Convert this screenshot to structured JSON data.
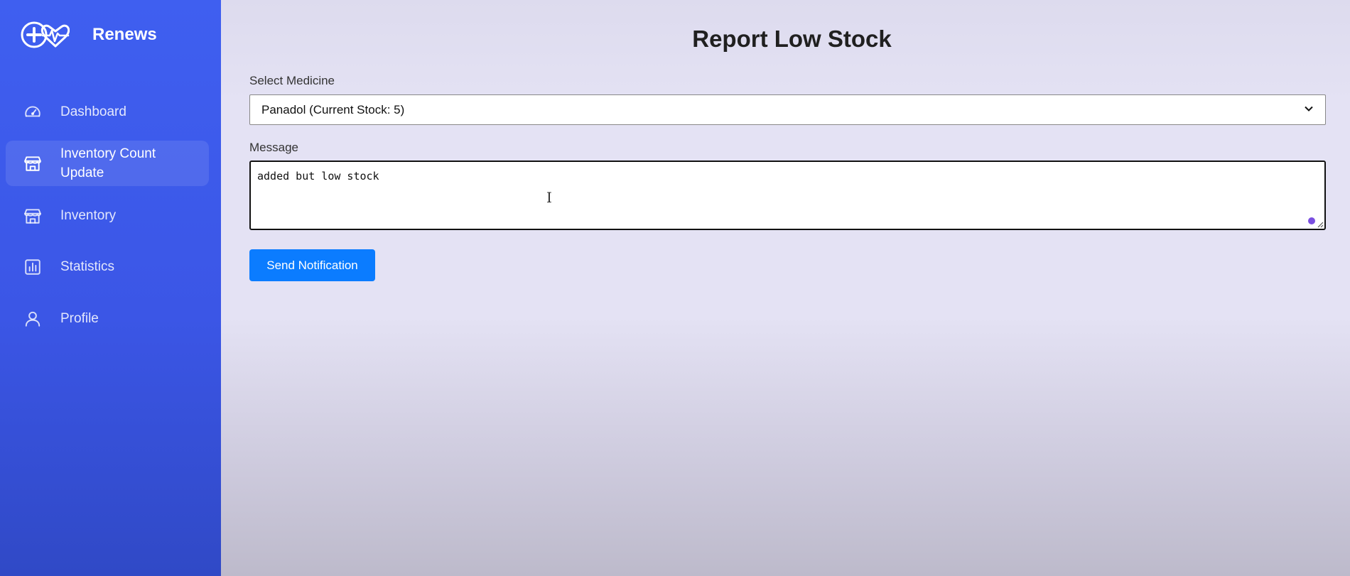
{
  "brand": {
    "name": "Renews",
    "logo_icon": "plus-heart-pulse-icon"
  },
  "sidebar": {
    "items": [
      {
        "label": "Dashboard",
        "icon": "gauge-icon",
        "active": false
      },
      {
        "label": "Inventory Count Update",
        "icon": "store-icon",
        "active": true
      },
      {
        "label": "Inventory",
        "icon": "store-icon",
        "active": false
      },
      {
        "label": "Statistics",
        "icon": "bar-chart-icon",
        "active": false
      },
      {
        "label": "Profile",
        "icon": "user-icon",
        "active": false
      }
    ]
  },
  "main": {
    "title": "Report Low Stock",
    "medicine_label": "Select Medicine",
    "medicine_selected": "Panadol (Current Stock: 5)",
    "message_label": "Message",
    "message_value": "added but low stock",
    "send_button": "Send Notification"
  },
  "colors": {
    "sidebar": "#3f5ff0",
    "button": "#0b7cff",
    "background": "#e4e2f4"
  }
}
